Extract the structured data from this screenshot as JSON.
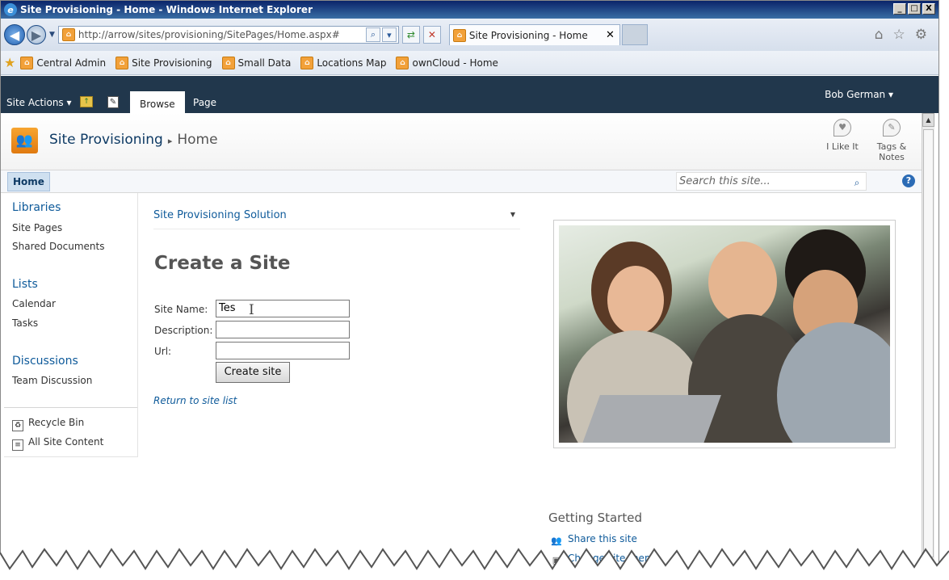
{
  "window": {
    "title": "Site Provisioning - Home - Windows Internet Explorer",
    "buttons": [
      "_",
      "□",
      "X"
    ]
  },
  "browser": {
    "url": "http://arrow/sites/provisioning/SitePages/Home.aspx#",
    "tab_title": "Site Provisioning - Home",
    "tab_close": "✕",
    "favorites": [
      {
        "label": "Central Admin"
      },
      {
        "label": "Site Provisioning"
      },
      {
        "label": "Small Data"
      },
      {
        "label": "Locations Map"
      },
      {
        "label": "ownCloud - Home"
      }
    ]
  },
  "ribbon": {
    "site_actions": "Site Actions ▾",
    "tabs": [
      {
        "label": "Browse"
      },
      {
        "label": "Page"
      }
    ],
    "user": "Bob German ▾"
  },
  "title_area": {
    "site_name": "Site Provisioning",
    "separator": "▸",
    "page_name": "Home",
    "social": [
      {
        "label": "I Like It"
      },
      {
        "label": "Tags & Notes"
      }
    ]
  },
  "top_nav": {
    "home": "Home",
    "search_placeholder": "Search this site...",
    "help": "?"
  },
  "left_nav": {
    "libraries_heading": "Libraries",
    "libraries": [
      "Site Pages",
      "Shared Documents"
    ],
    "lists_heading": "Lists",
    "lists": [
      "Calendar",
      "Tasks"
    ],
    "discussions_heading": "Discussions",
    "discussions": [
      "Team Discussion"
    ],
    "footer": [
      "Recycle Bin",
      "All Site Content"
    ]
  },
  "main": {
    "webpart_title": "Site Provisioning Solution",
    "heading": "Create a Site",
    "fields": [
      {
        "label": "Site Name:",
        "value": "Tes"
      },
      {
        "label": "Description:",
        "value": ""
      },
      {
        "label": "Url:",
        "value": ""
      }
    ],
    "create_button": "Create site",
    "return_link": "Return to site list"
  },
  "getting_started": {
    "heading": "Getting Started",
    "links": [
      "Share this site",
      "Change site theme"
    ]
  },
  "colors": {
    "ribbon_bg": "#21374c",
    "link_blue": "#0e5a9a",
    "logo_orange": "#f7a531"
  }
}
